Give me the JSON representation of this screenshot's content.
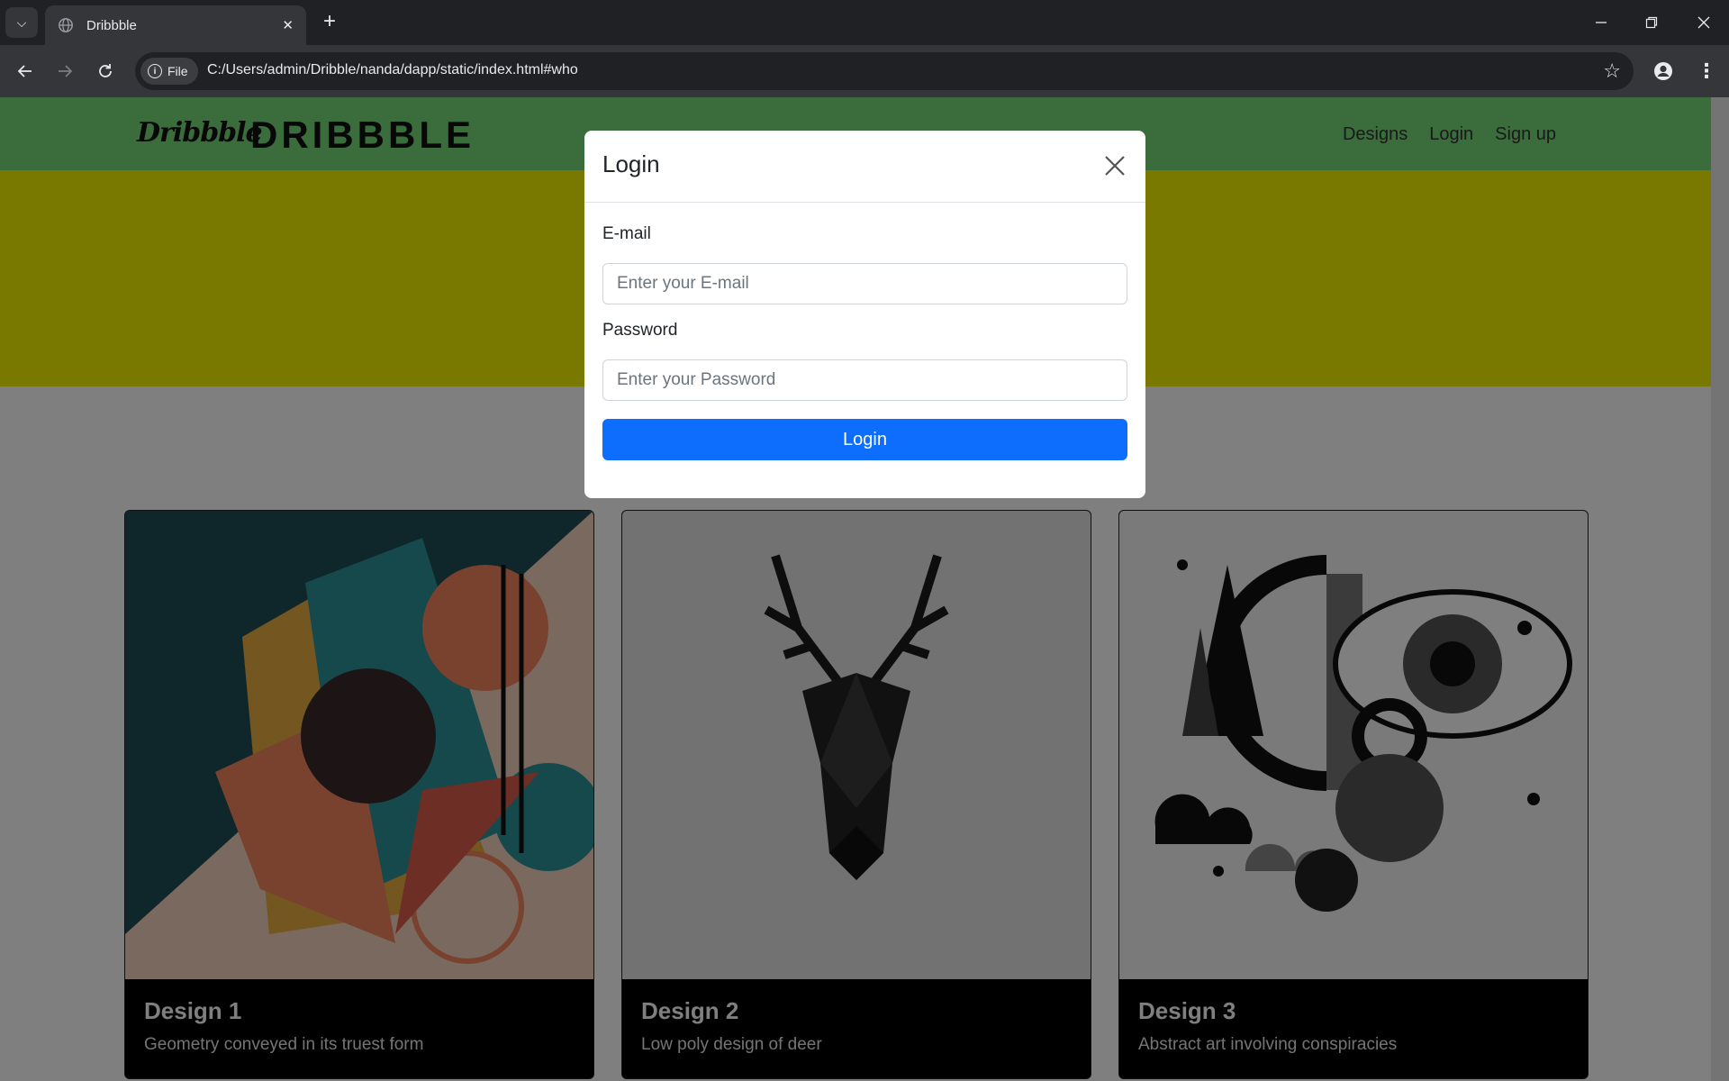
{
  "browser": {
    "tab_title": "Dribbble",
    "url_chip": "File",
    "url": "C:/Users/admin/Dribble/nanda/dapp/static/index.html#who"
  },
  "site": {
    "brand_script": "Dribbble",
    "brand_title": "DRIBBBLE",
    "nav": [
      "Designs",
      "Login",
      "Sign up"
    ],
    "colors": {
      "navbar": "#77d877",
      "hero": "#f2f200",
      "primary": "#0d6efd"
    }
  },
  "cards": [
    {
      "title": "Design 1",
      "description": "Geometry conveyed in its truest form"
    },
    {
      "title": "Design 2",
      "description": "Low poly design of deer"
    },
    {
      "title": "Design 3",
      "description": "Abstract art involving conspiracies"
    }
  ],
  "modal": {
    "title": "Login",
    "email_label": "E-mail",
    "email_placeholder": "Enter your E-mail",
    "email_value": "",
    "password_label": "Password",
    "password_placeholder": "Enter your Password",
    "password_value": "",
    "submit_label": "Login"
  }
}
